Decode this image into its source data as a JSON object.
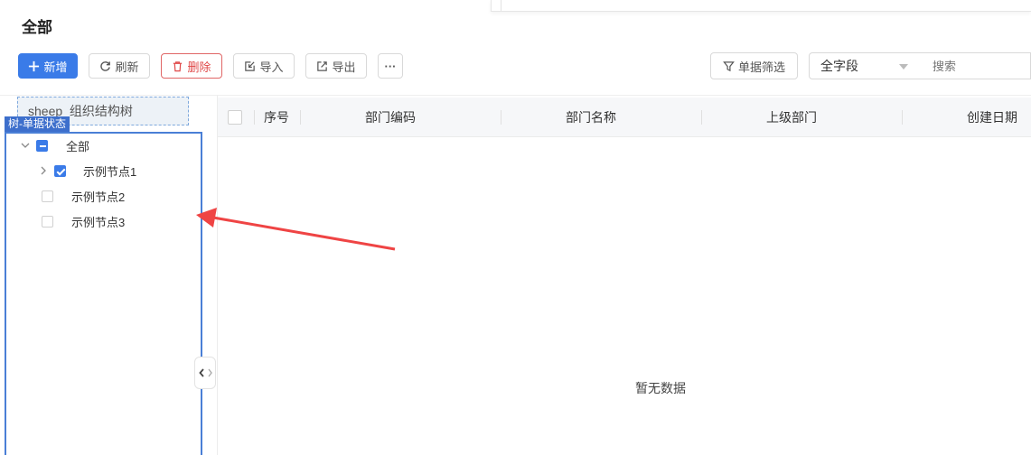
{
  "page": {
    "title": "全部"
  },
  "toolbar": {
    "add_label": "新增",
    "refresh_label": "刷新",
    "delete_label": "删除",
    "import_label": "导入",
    "export_label": "导出",
    "more_label": "···",
    "filter_label": "单据筛选",
    "field_select_value": "全字段",
    "search_placeholder": "搜索"
  },
  "tree": {
    "title": "sheep_组织结构树",
    "badge": "树-单据状态",
    "nodes": [
      {
        "label": "全部",
        "state": "indeterminate",
        "expanded": true
      },
      {
        "label": "示例节点1",
        "state": "checked",
        "expanded": false
      },
      {
        "label": "示例节点2",
        "state": "unchecked"
      },
      {
        "label": "示例节点3",
        "state": "unchecked"
      }
    ]
  },
  "table": {
    "columns": [
      "序号",
      "部门编码",
      "部门名称",
      "上级部门",
      "创建日期"
    ],
    "empty_text": "暂无数据"
  },
  "colors": {
    "primary": "#3a7be8",
    "danger": "#e04848",
    "annotation_arrow": "#ef4444",
    "tree_frame": "#4a7fd6"
  }
}
